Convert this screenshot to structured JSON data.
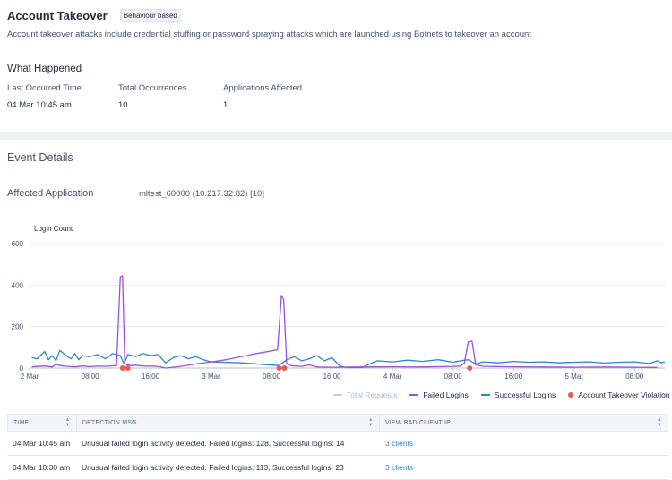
{
  "header": {
    "title": "Account Takeover",
    "badge": "Behaviour based",
    "description": "Account takeover attacks include credential stuffing or password spraying attacks which are launched using Botnets to takeover an account"
  },
  "what_happened": {
    "title": "What Happened",
    "stats": [
      {
        "label": "Last Occurred Time",
        "value": "04 Mar 10:45 am"
      },
      {
        "label": "Total Occurrences",
        "value": "10"
      },
      {
        "label": "Applications Affected",
        "value": "1"
      }
    ]
  },
  "event_details": {
    "title": "Event Details",
    "affected_application_label": "Affected Application",
    "affected_application_value": "mltest_60000 (10.217.32.82) [10]"
  },
  "colors": {
    "failed": "#9b4fe0",
    "successful": "#2a86cf",
    "violation": "#e85b5b",
    "total": "#c9ced6"
  },
  "chart_data": {
    "type": "line",
    "ylabel": "Login Count",
    "ylim": [
      0,
      600
    ],
    "yticks": [
      "0",
      "200",
      "400",
      "600"
    ],
    "xlim_hours": [
      0,
      84
    ],
    "xticks": [
      {
        "label": "2 Mar",
        "t": 0
      },
      {
        "label": "08:00",
        "t": 8
      },
      {
        "label": "16:00",
        "t": 16
      },
      {
        "label": "3 Mar",
        "t": 24
      },
      {
        "label": "08:00",
        "t": 32
      },
      {
        "label": "16:00",
        "t": 40
      },
      {
        "label": "4 Mar",
        "t": 48
      },
      {
        "label": "08:00",
        "t": 56
      },
      {
        "label": "16:00",
        "t": 64
      },
      {
        "label": "5 Mar",
        "t": 72
      },
      {
        "label": "08:00",
        "t": 80
      }
    ],
    "series": [
      {
        "name": "Failed Logins",
        "t": [
          0.3,
          2,
          3,
          3.5,
          4,
          5,
          6,
          7,
          8,
          9,
          10,
          11.5,
          12,
          12.3,
          12.6,
          13,
          13.5,
          14,
          15,
          16,
          17,
          18,
          20,
          22,
          24,
          26,
          28,
          30,
          32.8,
          33.3,
          33.6,
          34,
          34.5,
          35,
          36,
          37,
          38,
          40,
          44,
          48,
          52,
          56,
          57,
          57.5,
          58,
          58.5,
          59,
          60,
          62,
          64,
          68,
          72,
          76,
          80,
          83
        ],
        "values": [
          6,
          10,
          5,
          18,
          12,
          8,
          6,
          10,
          7,
          9,
          8,
          12,
          440,
          445,
          20,
          15,
          12,
          14,
          10,
          9,
          8,
          0,
          8,
          20,
          30,
          40,
          55,
          70,
          88,
          350,
          330,
          20,
          12,
          10,
          8,
          15,
          5,
          4,
          5,
          6,
          5,
          8,
          10,
          25,
          125,
          130,
          15,
          8,
          7,
          6,
          5,
          4,
          5,
          4,
          3
        ]
      },
      {
        "name": "Successful Logins",
        "t": [
          0.3,
          1,
          2,
          2.5,
          3,
          3.5,
          4,
          5,
          5.5,
          6,
          6.5,
          7,
          8,
          9,
          10,
          11,
          12,
          12.5,
          13,
          14,
          15,
          16,
          17,
          18,
          19,
          20,
          21,
          22,
          23,
          24,
          28,
          33,
          34,
          35,
          36,
          37,
          38,
          39,
          40,
          41,
          42,
          44,
          45,
          46,
          48,
          50,
          52,
          54,
          56,
          57,
          58,
          59,
          60,
          62,
          64,
          66,
          68,
          70,
          72,
          74,
          76,
          78,
          80,
          82,
          83,
          83.5,
          84
        ],
        "values": [
          50,
          45,
          80,
          40,
          60,
          35,
          85,
          55,
          45,
          70,
          40,
          60,
          55,
          65,
          45,
          70,
          60,
          20,
          65,
          55,
          70,
          60,
          65,
          25,
          50,
          60,
          45,
          55,
          40,
          30,
          25,
          12,
          40,
          55,
          35,
          45,
          60,
          35,
          50,
          10,
          2,
          3,
          20,
          35,
          30,
          38,
          32,
          40,
          28,
          35,
          40,
          20,
          30,
          25,
          32,
          28,
          30,
          25,
          28,
          30,
          24,
          28,
          30,
          22,
          35,
          25,
          30
        ]
      }
    ],
    "violations_t": [
      12.3,
      13.0,
      33.0,
      33.7,
      58.2
    ]
  },
  "legend": [
    {
      "label": "Total Requests",
      "type": "line",
      "color": "#c9ced6",
      "muted": true
    },
    {
      "label": "Failed Logins",
      "type": "line",
      "color": "#9b4fe0",
      "muted": false
    },
    {
      "label": "Successful Logins",
      "type": "line",
      "color": "#2a86cf",
      "muted": false
    },
    {
      "label": "Account Takeover Violation",
      "type": "dot",
      "color": "#e85b5b",
      "muted": false
    }
  ],
  "table": {
    "headers": [
      "TIME",
      "DETECTION MSG",
      "VIEW BAD CLIENT IP"
    ],
    "rows": [
      {
        "time": "04 Mar 10:45 am",
        "msg": "Unusual failed login activity detected. Failed logins: 128, Successful logins: 14",
        "clients": "3 clients"
      },
      {
        "time": "04 Mar 10:30 am",
        "msg": "Unusual failed login activity detected. Failed logins: 113, Successful logins: 23",
        "clients": "3 clients"
      }
    ]
  }
}
